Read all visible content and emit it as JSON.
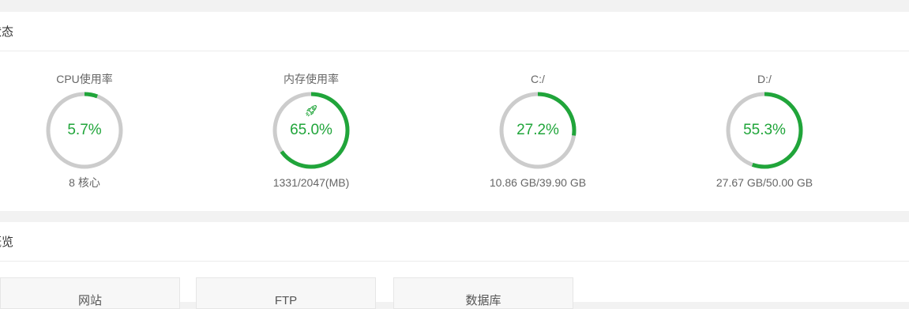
{
  "status_panel": {
    "title": "状态",
    "gauges": [
      {
        "label": "CPU使用率",
        "value_text": "5.7%",
        "percent": 5.7,
        "sub": "8 核心"
      },
      {
        "label": "内存使用率",
        "value_text": "65.0%",
        "percent": 65.0,
        "sub": "1331/2047(MB)",
        "icon": "rocket-icon"
      },
      {
        "label": "C:/",
        "value_text": "27.2%",
        "percent": 27.2,
        "sub": "10.86 GB/39.90 GB"
      },
      {
        "label": "D:/",
        "value_text": "55.3%",
        "percent": 55.3,
        "sub": "27.67 GB/50.00 GB"
      }
    ]
  },
  "overview_panel": {
    "title": "概览",
    "cards": [
      "网站",
      "FTP",
      "数据库"
    ]
  },
  "colors": {
    "accent": "#20a53a",
    "track": "#cccccc"
  }
}
